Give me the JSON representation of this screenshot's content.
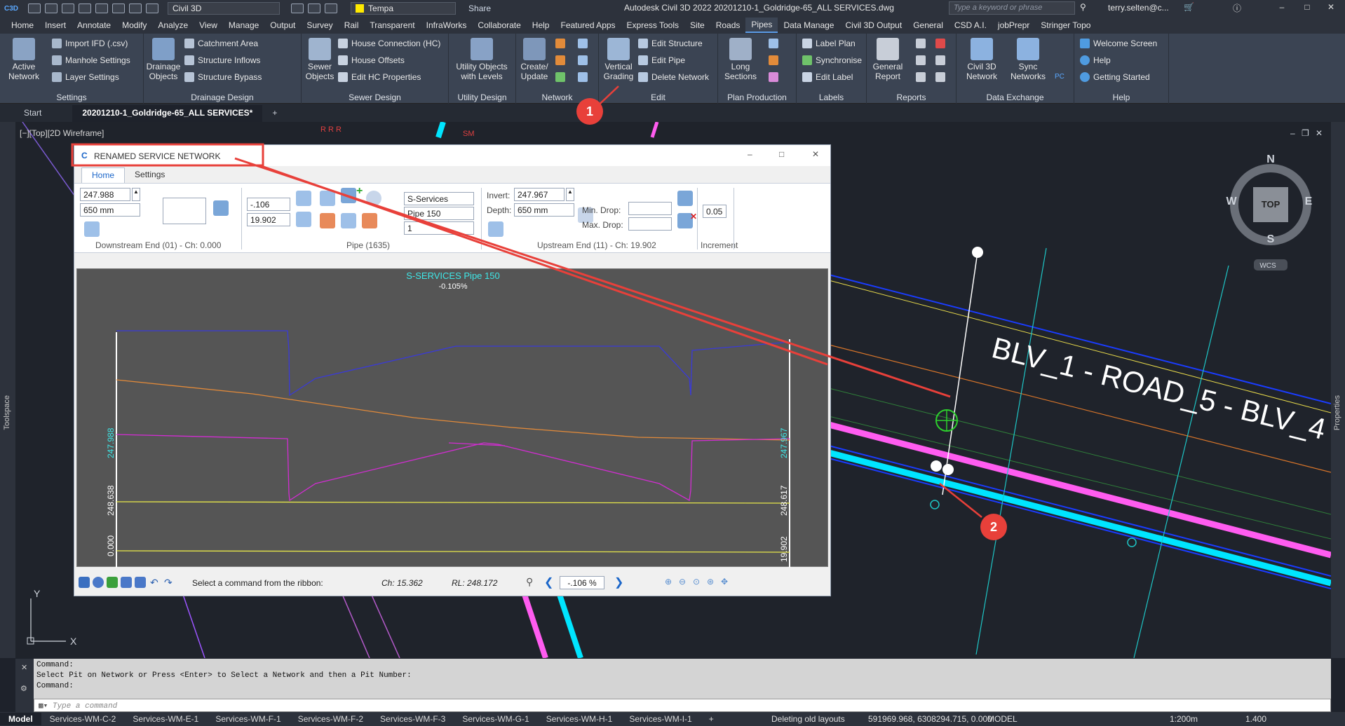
{
  "titlebar": {
    "app_icon": "C3D",
    "workspace": "Civil 3D",
    "layer": "Tempa",
    "share": "Share",
    "title": "Autodesk Civil 3D 2022   20201210-1_Goldridge-65_ALL SERVICES.dwg",
    "search_placeholder": "Type a keyword or phrase",
    "user": "terry.selten@c...",
    "layer_color": "#ffea00"
  },
  "menu": [
    "Home",
    "Insert",
    "Annotate",
    "Modify",
    "Analyze",
    "View",
    "Manage",
    "Output",
    "Survey",
    "Rail",
    "Transparent",
    "InfraWorks",
    "Collaborate",
    "Help",
    "Featured Apps",
    "Express Tools",
    "Site",
    "Roads",
    "Pipes",
    "Data Manage",
    "Civil 3D Output",
    "General",
    "CSD A.I.",
    "jobPrepr",
    "Stringer Topo"
  ],
  "menu_active": "Pipes",
  "ribbon": {
    "settings": {
      "title": "Settings",
      "active_network": "Active Network",
      "import_ifd": "Import IFD (.csv)",
      "manhole_settings": "Manhole Settings",
      "layer_settings": "Layer Settings"
    },
    "drainage": {
      "title": "Drainage Design",
      "drainage_objects": "Drainage Objects",
      "catchment_area": "Catchment Area",
      "structure_inflows": "Structure Inflows",
      "structure_bypass": "Structure Bypass"
    },
    "sewer": {
      "title": "Sewer Design",
      "sewer_objects": "Sewer Objects",
      "house_connection": "House Connection (HC)",
      "house_offsets": "House Offsets",
      "edit_hc": "Edit HC Properties"
    },
    "utility": {
      "title": "Utility Design",
      "utility_objects": "Utility Objects with Levels"
    },
    "network": {
      "title": "Network",
      "create_update": "Create/ Update"
    },
    "edit": {
      "title": "Edit",
      "vertical_grading": "Vertical Grading",
      "edit_structure": "Edit Structure",
      "edit_pipe": "Edit Pipe",
      "delete_network": "Delete Network"
    },
    "plan": {
      "title": "Plan Production",
      "long_sections": "Long Sections"
    },
    "labels": {
      "title": "Labels",
      "label_plan": "Label Plan",
      "synchronise": "Synchronise",
      "edit_label": "Edit Label"
    },
    "reports": {
      "title": "Reports",
      "general_report": "General Report"
    },
    "data_exchange": {
      "title": "Data Exchange",
      "civil3d_network": "Civil 3D Network",
      "sync_networks": "Sync Networks",
      "pc": "PC"
    },
    "help": {
      "title": "Help",
      "welcome": "Welcome Screen",
      "help": "Help",
      "getting_started": "Getting Started"
    }
  },
  "doc_tabs": [
    "Start",
    "20201210-1_Goldridge-65_ALL SERVICES*"
  ],
  "viewport": {
    "label": "[−][Top][2D Wireframe]",
    "road_label": "BLV_1 - ROAD_5 - BLV_4",
    "compass": {
      "n": "N",
      "s": "S",
      "e": "E",
      "w": "W",
      "top": "TOP",
      "wcs": "WCS"
    },
    "toolspace": "Toolspace",
    "properties": "Properties",
    "ucs_x": "X",
    "ucs_y": "Y",
    "sm_label": "SM",
    "sm_mark": "R R R"
  },
  "dialog": {
    "title": "RENAMED SERVICE NETWORK",
    "tabs": [
      "Home",
      "Settings"
    ],
    "downstream": {
      "invert": "247.988",
      "depth": "650 mm",
      "title": "Downstream End (01) - Ch: 0.000"
    },
    "pipe": {
      "grade": "-.106",
      "length": "19.902",
      "network": "S-Services",
      "size": "Pipe 150",
      "count": "1",
      "title": "Pipe (1635)"
    },
    "upstream": {
      "invert_label": "Invert:",
      "invert": "247.967",
      "depth_label": "Depth:",
      "depth": "650 mm",
      "min_drop": "Min. Drop:",
      "max_drop": "Max. Drop:",
      "title": "Upstream End (11) - Ch: 19.902"
    },
    "increment": {
      "value": "0.05",
      "title": "Increment"
    },
    "profile": {
      "title": "S-SERVICES Pipe 150",
      "grade": "-0.105%",
      "left_invert": "247.988",
      "left_rl": "248.638",
      "left_ch": "0.000",
      "right_invert": "247.967",
      "right_rl": "248.617",
      "right_ch": "19.902"
    },
    "status": {
      "message": "Select a command from the ribbon:",
      "ch": "Ch: 15.362",
      "rl": "RL: 248.172",
      "grade_value": "-.106 %"
    }
  },
  "command": {
    "lines": [
      "Command:",
      "Select Pit on Network or Press <Enter> to Select a Network and then a Pit Number:",
      "Command:"
    ],
    "placeholder": "Type a command"
  },
  "statusbar": {
    "tabs": [
      "Model",
      "Services-WM-C-2",
      "Services-WM-E-1",
      "Services-WM-F-1",
      "Services-WM-F-2",
      "Services-WM-F-3",
      "Services-WM-G-1",
      "Services-WM-H-1",
      "Services-WM-I-1"
    ],
    "message": "Deleting old layouts",
    "coords": "591969.968, 6308294.715, 0.000",
    "model": "MODEL",
    "scale": "1:200m",
    "lineweight": "1.400"
  },
  "callouts": [
    "1",
    "2"
  ],
  "colors": {
    "accent": "#5a9be6",
    "annotation_red": "#e8403a",
    "cyan": "#00e5ff",
    "magenta": "#ff5cf0"
  }
}
